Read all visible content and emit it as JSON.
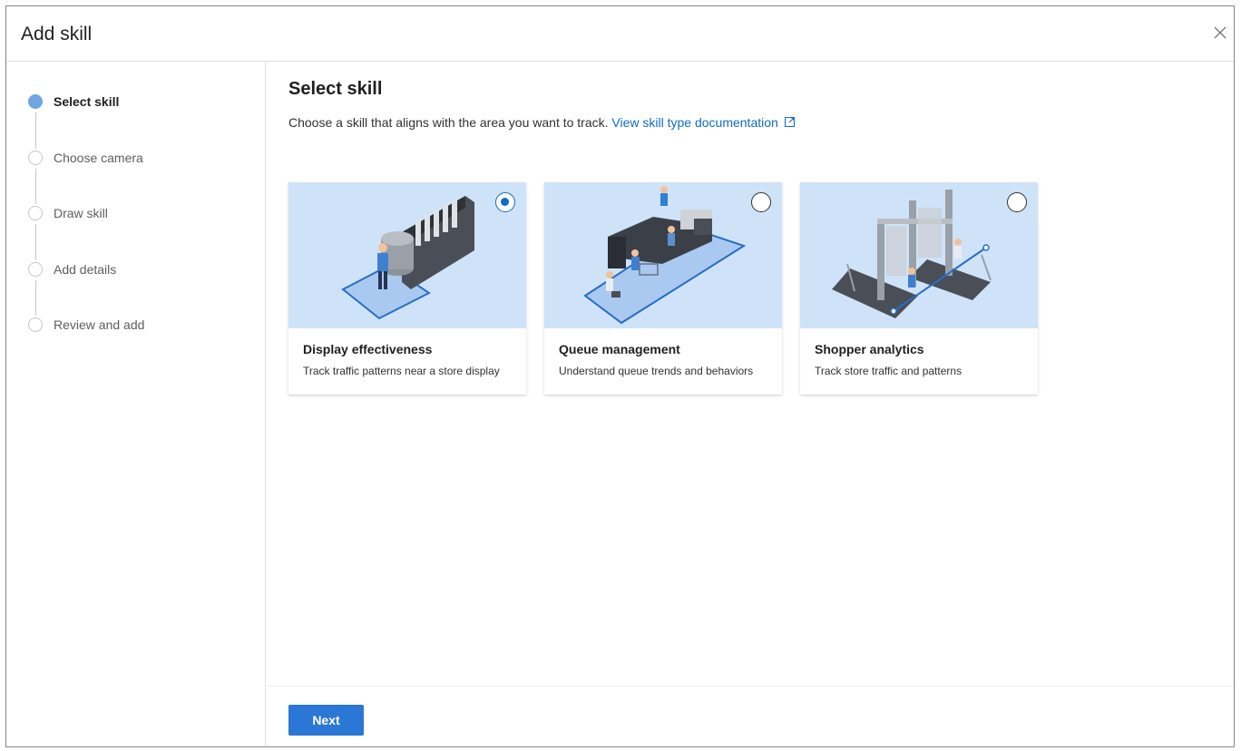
{
  "dialog": {
    "title": "Add skill",
    "close_icon": "close-icon"
  },
  "steps": [
    {
      "label": "Select skill",
      "state": "active"
    },
    {
      "label": "Choose camera",
      "state": "pending"
    },
    {
      "label": "Draw skill",
      "state": "pending"
    },
    {
      "label": "Add details",
      "state": "pending"
    },
    {
      "label": "Review and add",
      "state": "pending"
    }
  ],
  "main": {
    "title": "Select skill",
    "description": "Choose a skill that aligns with the area you want to track.",
    "doc_link": "View skill type documentation",
    "doc_link_icon": "external-link-icon"
  },
  "cards": [
    {
      "title": "Display effectiveness",
      "description": "Track traffic patterns near a store display",
      "selected": true
    },
    {
      "title": "Queue management",
      "description": "Understand queue trends and behaviors",
      "selected": false
    },
    {
      "title": "Shopper analytics",
      "description": "Track store traffic and patterns",
      "selected": false
    }
  ],
  "footer": {
    "next_label": "Next"
  },
  "colors": {
    "accent": "#0f6cbd",
    "button": "#2b77d6",
    "step_active": "#6fa6e2",
    "card_illustration_bg": "#cfe3f8"
  }
}
